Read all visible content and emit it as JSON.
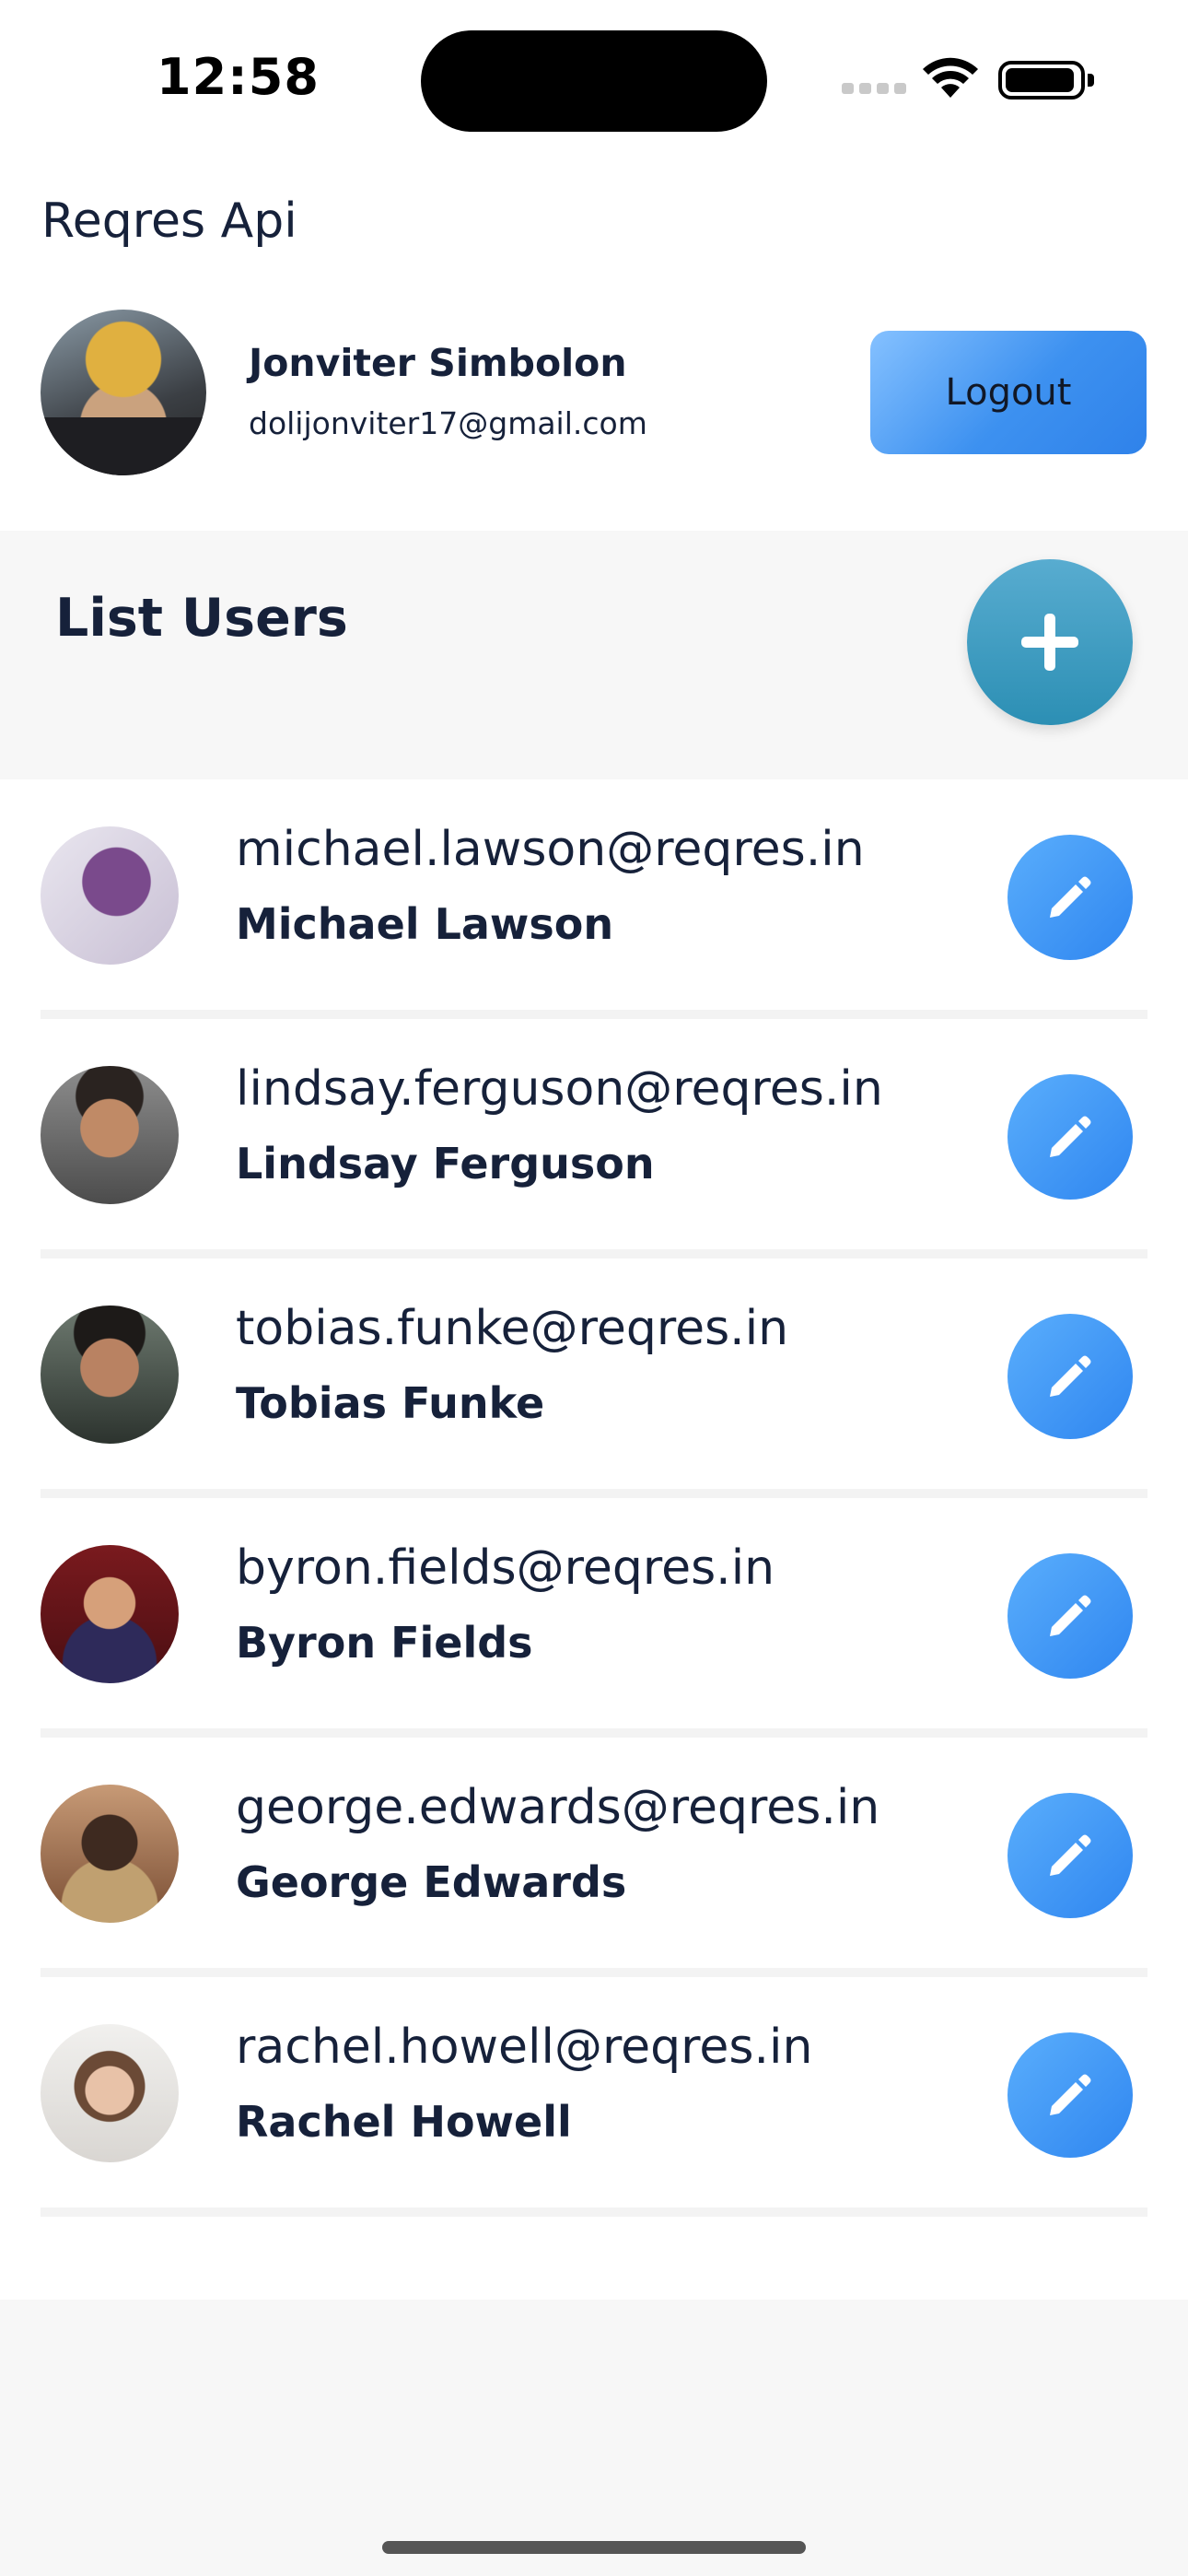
{
  "status_bar": {
    "time": "12:58"
  },
  "header": {
    "app_title": "Reqres Api",
    "profile": {
      "name": "Jonviter Simbolon",
      "email": "dolijonviter17@gmail.com"
    },
    "logout_label": "Logout"
  },
  "list": {
    "title": "List Users",
    "users": [
      {
        "email": "michael.lawson@reqres.in",
        "name": "Michael Lawson"
      },
      {
        "email": "lindsay.ferguson@reqres.in",
        "name": "Lindsay Ferguson"
      },
      {
        "email": "tobias.funke@reqres.in",
        "name": "Tobias Funke"
      },
      {
        "email": "byron.fields@reqres.in",
        "name": "Byron Fields"
      },
      {
        "email": "george.edwards@reqres.in",
        "name": "George Edwards"
      },
      {
        "email": "rachel.howell@reqres.in",
        "name": "Rachel Howell"
      }
    ]
  },
  "icons": {
    "add": "plus-icon",
    "edit": "pencil-icon",
    "wifi": "wifi-icon",
    "battery": "battery-icon",
    "signal": "signal-icon"
  },
  "colors": {
    "accent_blue": "#3d91f0",
    "add_button": "#3a9bc2",
    "text_dark": "#16213a"
  }
}
